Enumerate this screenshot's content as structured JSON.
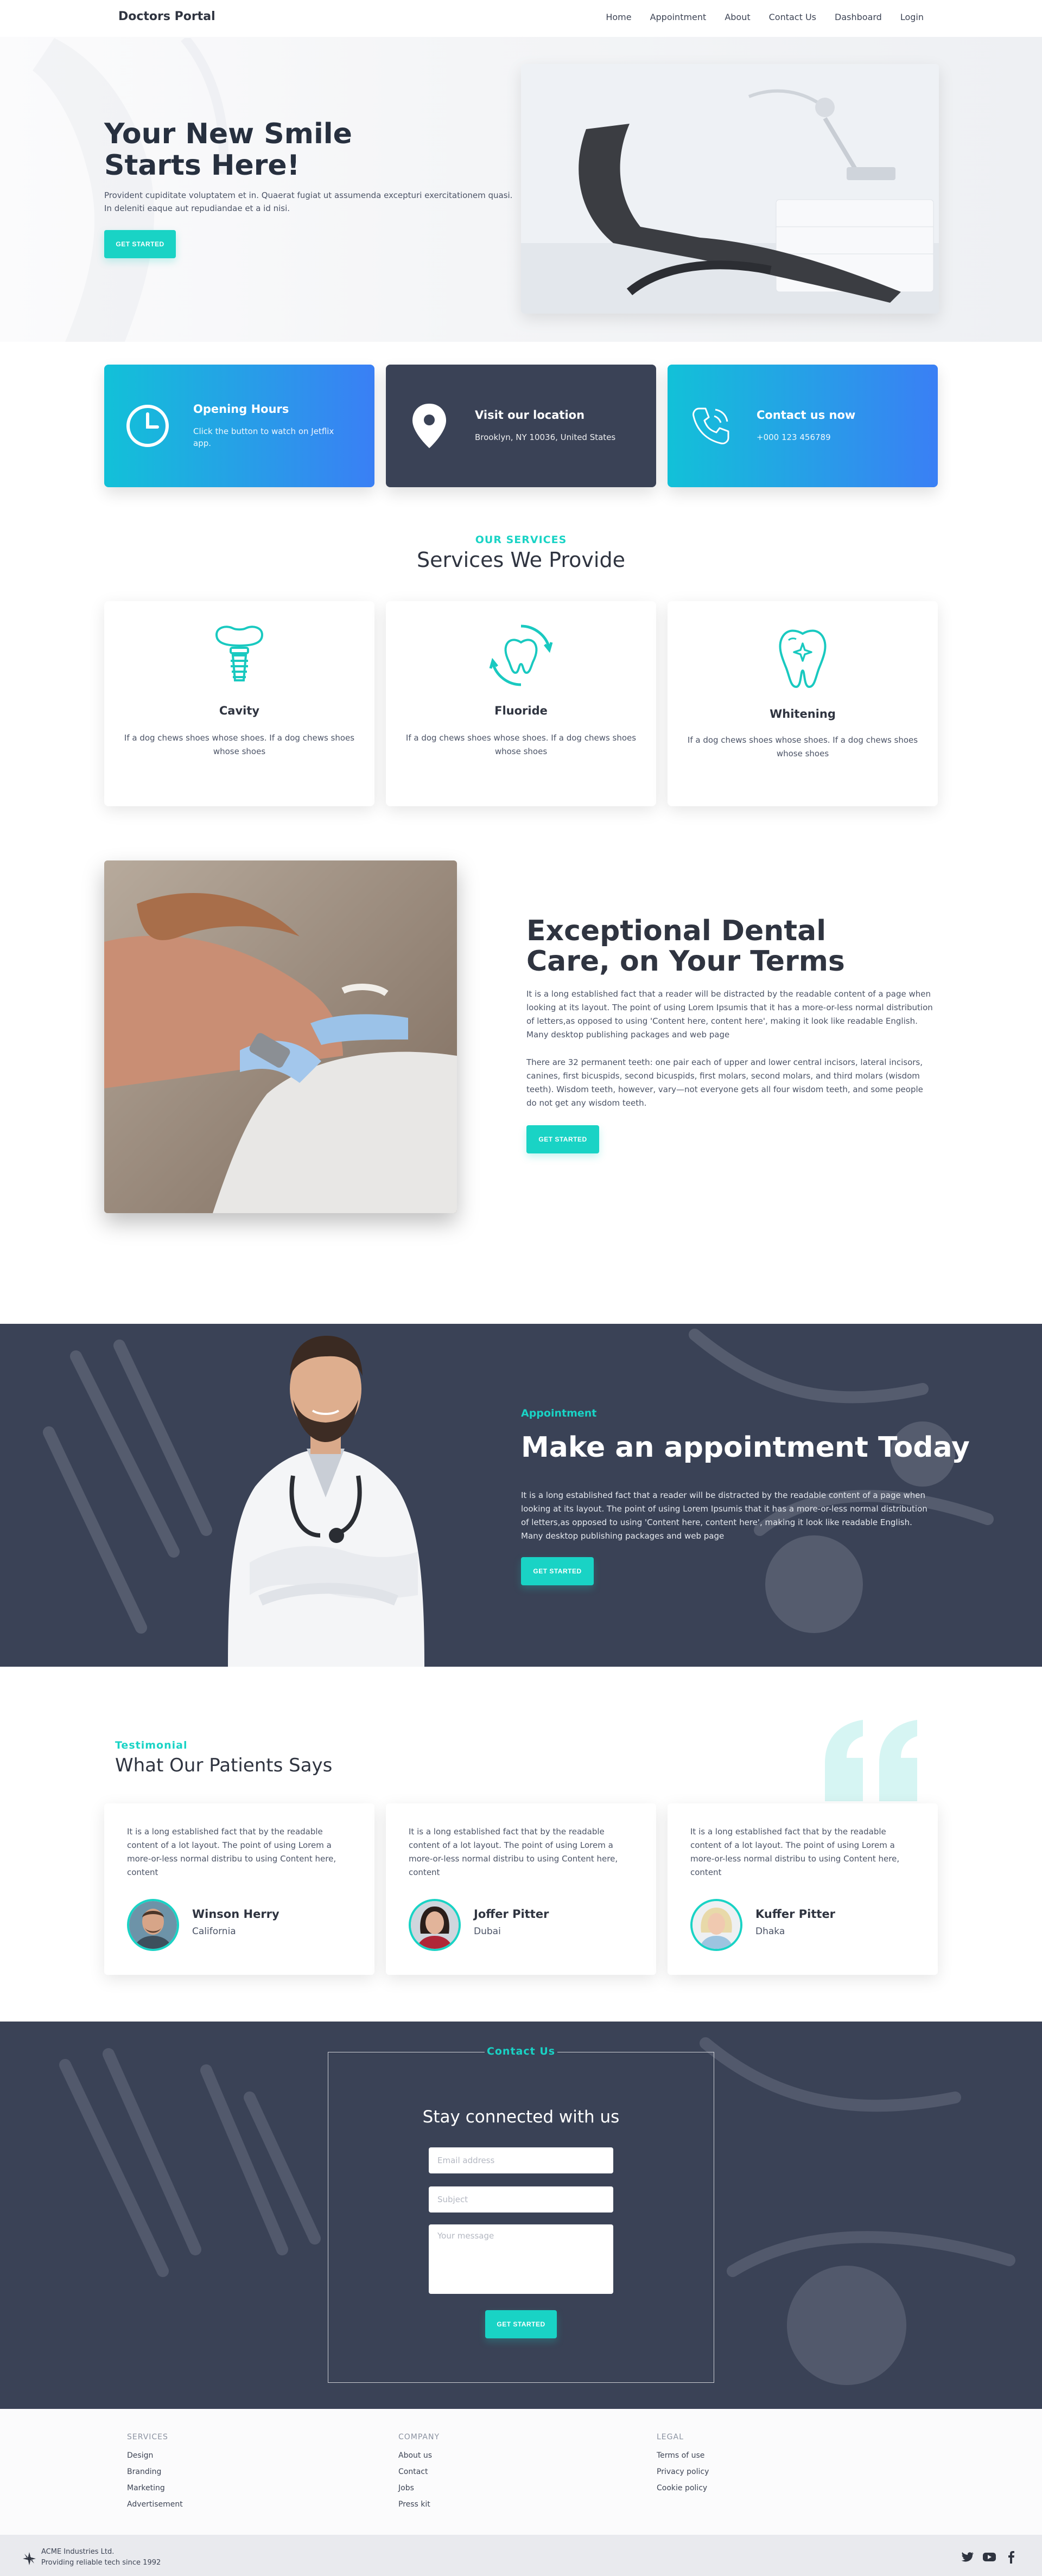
{
  "nav": {
    "brand": "Doctors Portal",
    "links": [
      "Home",
      "Appointment",
      "About",
      "Contact Us",
      "Dashboard",
      "Login"
    ]
  },
  "hero": {
    "title": "Your New Smile Starts Here!",
    "text": "Provident cupiditate voluptatem et in. Quaerat fugiat ut assumenda excepturi exercitationem quasi. In deleniti eaque aut repudiandae et a id nisi.",
    "button": "GET STARTED"
  },
  "info_cards": [
    {
      "title": "Opening Hours",
      "text": "Click the button to watch on Jetflix app.",
      "icon": "clock-icon"
    },
    {
      "title": "Visit our location",
      "text": "Brooklyn, NY 10036, United States",
      "icon": "map-pin-icon"
    },
    {
      "title": "Contact us now",
      "text": "+000 123 456789",
      "icon": "phone-icon"
    }
  ],
  "services": {
    "kicker": "OUR SERVICES",
    "title": "Services We Provide",
    "items": [
      {
        "name": "Cavity",
        "text": "If a dog chews shoes whose shoes. If a dog chews shoes whose shoes",
        "icon": "tooth-implant-icon"
      },
      {
        "name": "Fluoride",
        "text": "If a dog chews shoes whose shoes. If a dog chews shoes whose shoes",
        "icon": "tooth-refresh-icon"
      },
      {
        "name": "Whitening",
        "text": "If a dog chews shoes whose shoes. If a dog chews shoes whose shoes",
        "icon": "tooth-sparkle-icon"
      }
    ]
  },
  "exceptional": {
    "title": "Exceptional Dental Care, on Your Terms",
    "p1": "It is a long established fact that a reader will be distracted by the readable content of a page when looking at its layout. The point of using Lorem Ipsumis that it has a more-or-less normal distribution of letters,as opposed to using 'Content here, content here', making it look like readable English. Many desktop publishing packages and web page",
    "p2": "There are 32 permanent teeth: one pair each of upper and lower central incisors, lateral incisors, canines, first bicuspids, second bicuspids, first molars, second molars, and third molars (wisdom teeth). Wisdom teeth, however, vary—not everyone gets all four wisdom teeth, and some people do not get any wisdom teeth.",
    "button": "GET STARTED"
  },
  "appointment": {
    "kicker": "Appointment",
    "title": "Make an appointment Today",
    "text": "It is a long established fact that a reader will be distracted by the readable content of a page when looking at its layout. The point of using Lorem Ipsumis that it has a more-or-less normal distribution of letters,as opposed to using 'Content here, content here', making it look like readable English. Many desktop publishing packages and web page",
    "button": "GET STARTED"
  },
  "testimonial": {
    "kicker": "Testimonial",
    "title": "What Our Patients Says",
    "items": [
      {
        "text": "It is a long established fact that by the readable content of a lot layout. The point of using Lorem a more-or-less normal distribu to using Content here, content",
        "name": "Winson Herry",
        "location": "California"
      },
      {
        "text": "It is a long established fact that by the readable content of a lot layout. The point of using Lorem a more-or-less normal distribu to using Content here, content",
        "name": "Joffer Pitter",
        "location": "Dubai"
      },
      {
        "text": "It is a long established fact that by the readable content of a lot layout. The point of using Lorem a more-or-less normal distribu to using Content here, content",
        "name": "Kuffer Pitter",
        "location": "Dhaka"
      }
    ]
  },
  "contact": {
    "kicker": "Contact Us",
    "title": "Stay connected with us",
    "email_placeholder": "Email address",
    "subject_placeholder": "Subject",
    "message_placeholder": "Your message",
    "button": "GET STARTED"
  },
  "footer": {
    "columns": [
      {
        "heading": "SERVICES",
        "links": [
          "Design",
          "Branding",
          "Marketing",
          "Advertisement"
        ]
      },
      {
        "heading": "COMPANY",
        "links": [
          "About us",
          "Contact",
          "Jobs",
          "Press kit"
        ]
      },
      {
        "heading": "LEGAL",
        "links": [
          "Terms of use",
          "Privacy policy",
          "Cookie policy"
        ]
      }
    ],
    "company": "ACME Industries Ltd.",
    "tagline": "Providing reliable tech since 1992",
    "social": [
      "twitter-icon",
      "youtube-icon",
      "facebook-icon"
    ]
  },
  "colors": {
    "accent": "#19d3c5",
    "dark": "#3a4256",
    "gradient_start": "#12c1d8",
    "gradient_end": "#3a7ff5"
  }
}
